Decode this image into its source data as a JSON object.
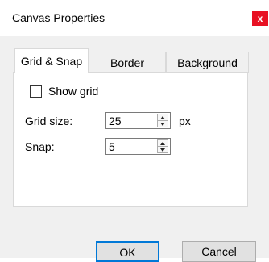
{
  "window": {
    "title": "Canvas Properties",
    "close_label": "x"
  },
  "tabs": [
    {
      "label": "Grid & Snap",
      "active": true
    },
    {
      "label": "Border",
      "active": false
    },
    {
      "label": "Background",
      "active": false
    }
  ],
  "grid_snap": {
    "show_grid_label": "Show grid",
    "show_grid_checked": false,
    "grid_size_label": "Grid size:",
    "grid_size_value": "25",
    "grid_size_unit": "px",
    "snap_label": "Snap:",
    "snap_value": "5"
  },
  "buttons": {
    "ok_label": "OK",
    "cancel_label": "Cancel"
  },
  "colors": {
    "close_button": "#e81123",
    "default_button_border": "#0078d7"
  }
}
